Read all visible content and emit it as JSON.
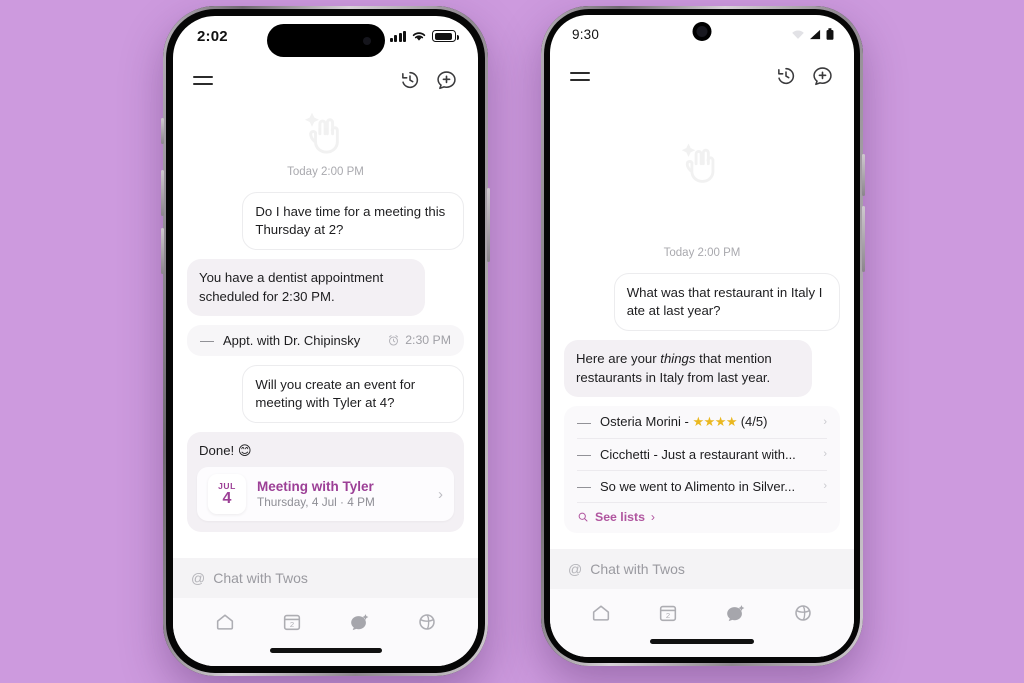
{
  "background_color": "#cd9ade",
  "brand": {
    "accent_purple": "#9c3f96",
    "link_purple": "#b0559f",
    "logo_name": "twos-peace-hand-logo"
  },
  "phones": [
    {
      "id": "ios",
      "platform": "iOS",
      "status_bar": {
        "time": "2:02",
        "icons": [
          "cellular-signal-icon",
          "wifi-icon",
          "battery-icon"
        ]
      },
      "app_bar": {
        "menu_icon": "hamburger-menu-icon",
        "history_icon": "history-clock-icon",
        "new_chat_icon": "new-chat-plus-icon"
      },
      "chat": {
        "day_stamp": "Today 2:00 PM",
        "messages": [
          {
            "kind": "out-bubble",
            "text": "Do I have time for a meeting this Thursday at 2?"
          },
          {
            "kind": "in-bubble",
            "text": "You have a dentist appointment scheduled for 2:30 PM."
          },
          {
            "kind": "item-card",
            "text": "Appt. with Dr. Chipinsky",
            "meta": "2:30 PM",
            "meta_icon": "alarm-clock-icon"
          },
          {
            "kind": "out-bubble",
            "text": "Will you create an event for meeting with Tyler at 4?"
          },
          {
            "kind": "done-event-card",
            "text": "Done! 😊",
            "event": {
              "month": "JUL",
              "day": "4",
              "title": "Meeting with Tyler",
              "subtitle": "Thursday, 4 Jul · 4 PM",
              "chevron": "›"
            }
          }
        ]
      },
      "composer": {
        "at_symbol": "@",
        "placeholder": "Chat with Twos",
        "value": ""
      },
      "nav": [
        {
          "icon": "home-icon",
          "label": "Home",
          "active": false
        },
        {
          "icon": "calendar-icon",
          "label": "Calendar",
          "badge": "2",
          "active": false
        },
        {
          "icon": "chat-sparkle-icon",
          "label": "Chat",
          "active": true
        },
        {
          "icon": "globe-icon",
          "label": "Explore",
          "active": false
        }
      ]
    },
    {
      "id": "android",
      "platform": "Android",
      "status_bar": {
        "time": "9:30",
        "icons": [
          "wifi-icon",
          "cellular-signal-icon",
          "battery-icon"
        ]
      },
      "app_bar": {
        "menu_icon": "hamburger-menu-icon",
        "history_icon": "history-clock-icon",
        "new_chat_icon": "new-chat-plus-icon"
      },
      "chat": {
        "day_stamp": "Today 2:00 PM",
        "messages": [
          {
            "kind": "out-bubble",
            "text": "What was that restaurant in Italy I ate at last year?"
          },
          {
            "kind": "in-bubble-rich",
            "text_before": "Here are your ",
            "emphasis": "things",
            "text_after": " that mention restaurants in Italy from last year."
          },
          {
            "kind": "list-card",
            "items": [
              {
                "text_before": "Osteria Morini - ",
                "stars": "★★★★",
                "text_after": " (4/5)",
                "chevron": "›"
              },
              {
                "text": "Cicchetti - Just a restaurant with...",
                "chevron": "›"
              },
              {
                "text": "So we went to Alimento in Silver...",
                "chevron": "›"
              }
            ],
            "footer": {
              "icon": "search-icon",
              "label": "See lists",
              "chevron": "›"
            }
          }
        ]
      },
      "composer": {
        "at_symbol": "@",
        "placeholder": "Chat with Twos",
        "value": ""
      },
      "nav": [
        {
          "icon": "home-icon",
          "label": "Home",
          "active": false
        },
        {
          "icon": "calendar-icon",
          "label": "Calendar",
          "badge": "2",
          "active": false
        },
        {
          "icon": "chat-sparkle-icon",
          "label": "Chat",
          "active": true
        },
        {
          "icon": "globe-icon",
          "label": "Explore",
          "active": false
        }
      ]
    }
  ]
}
